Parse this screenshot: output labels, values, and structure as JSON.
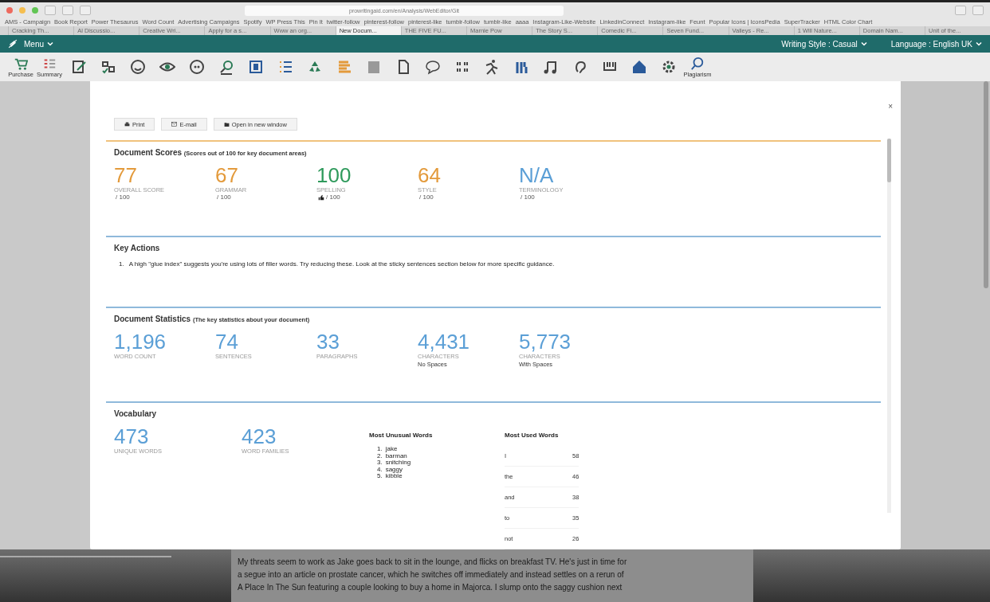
{
  "browser": {
    "url": "prowritingaid.com/en/Analysis/WebEditor/Git",
    "bookmarks": [
      "AMS - Campaign",
      "Book Report",
      "Power Thesaurus",
      "Word Count",
      "Advertising Campaigns",
      "Spotify",
      "WP Press This",
      "Pin It",
      "twitter-follow",
      "pinterest-follow",
      "pinterest-like",
      "tumblr-follow",
      "tumblr-like",
      "aaaa",
      "Instagram-Like-Website",
      "LinkedinConnect",
      "Instagram-like",
      "Feunt",
      "Popular Icons | IconsPedia",
      "SuperTracker",
      "HTML Color Chart"
    ],
    "tabs": [
      {
        "label": "Cracking Th...",
        "selected": false
      },
      {
        "label": "Al Discussio...",
        "selected": false
      },
      {
        "label": "Creative Wri...",
        "selected": false
      },
      {
        "label": "Apply for a s...",
        "selected": false
      },
      {
        "label": "Www an org...",
        "selected": false
      },
      {
        "label": "New Docum...",
        "selected": true
      },
      {
        "label": "THE FIVE FU...",
        "selected": false
      },
      {
        "label": "Marnie Pow",
        "selected": false
      },
      {
        "label": "The Story S...",
        "selected": false
      },
      {
        "label": "Comedic Fi...",
        "selected": false
      },
      {
        "label": "Seven Fund...",
        "selected": false
      },
      {
        "label": "Valleys - Re...",
        "selected": false
      },
      {
        "label": "1 Will Nature...",
        "selected": false
      },
      {
        "label": "Domain Nam...",
        "selected": false
      },
      {
        "label": "Unit of the...",
        "selected": false
      }
    ]
  },
  "app_bar": {
    "menu": "Menu",
    "writing_style": "Writing Style : Casual",
    "language": "Language : English UK"
  },
  "toolbar": {
    "purchase": "Purchase",
    "summary": "Summary",
    "plagiarism": "Plagiarism"
  },
  "report": {
    "actions": [
      "Print",
      "E-mail",
      "Open in new window"
    ],
    "close": "×",
    "scores": {
      "title": "Document Scores",
      "subtitle": "(Scores out of 100 for key document areas)",
      "items": [
        {
          "kind": "plain",
          "value": "77",
          "label": "OVERALL SCORE",
          "out_of": "/ 100",
          "color": "#e39a3b"
        },
        {
          "kind": "plain",
          "value": "67",
          "label": "GRAMMAR",
          "out_of": "/ 100",
          "color": "#e39a3b"
        },
        {
          "kind": "approved",
          "value": "100",
          "label": "SPELLING",
          "out_of": "/ 100",
          "color": "#2f9a5c"
        },
        {
          "kind": "plain",
          "value": "64",
          "label": "STYLE",
          "out_of": "/ 100",
          "color": "#e39a3b"
        },
        {
          "kind": "plain",
          "value": "N/A",
          "label": "TERMINOLOGY",
          "out_of": "/ 100",
          "color": "#5b9fd6"
        }
      ]
    },
    "key_actions": {
      "title": "Key Actions",
      "items": [
        {
          "number": "1.",
          "text": "A high \"glue index\" suggests you're using lots of filler words. Try reducing these. Look at the sticky sentences section below for more specific guidance."
        }
      ]
    },
    "statistics": {
      "title": "Document Statistics",
      "subtitle": "(The key statistics about your document)",
      "items": [
        {
          "value": "1,196",
          "label": "WORD COUNT"
        },
        {
          "value": "74",
          "label": "SENTENCES"
        },
        {
          "value": "33",
          "label": "PARAGRAPHS"
        },
        {
          "value": "4,431",
          "label": "CHARACTERS",
          "note": "No Spaces"
        },
        {
          "value": "5,773",
          "label": "CHARACTERS",
          "note": "With Spaces"
        }
      ]
    },
    "vocabulary": {
      "title": "Vocabulary",
      "items": [
        {
          "value": "473",
          "label": "UNIQUE WORDS"
        },
        {
          "value": "423",
          "label": "WORD FAMILIES"
        }
      ],
      "unusual": {
        "title": "Most Unusual Words",
        "words": [
          {
            "number": "1.",
            "word": "jake"
          },
          {
            "number": "2.",
            "word": "barman"
          },
          {
            "number": "3.",
            "word": "snitching"
          },
          {
            "number": "4.",
            "word": "saggy"
          },
          {
            "number": "5.",
            "word": "kibble"
          }
        ]
      },
      "used": {
        "title": "Most Used Words",
        "rows": [
          {
            "word": "I",
            "count": "58"
          },
          {
            "word": "the",
            "count": "46"
          },
          {
            "word": "and",
            "count": "38"
          },
          {
            "word": "to",
            "count": "35"
          },
          {
            "word": "not",
            "count": "26"
          }
        ]
      }
    }
  },
  "document": {
    "lines": [
      "My threats seem to work as Jake goes back to sit in the lounge, and flicks on breakfast TV. He's just in time for",
      "a segue into an article on prostate cancer, which he switches off immediately and instead settles on a rerun of",
      "A Place In The Sun featuring a couple looking to buy a home in Majorca. I slump onto the saggy cushion next"
    ]
  }
}
